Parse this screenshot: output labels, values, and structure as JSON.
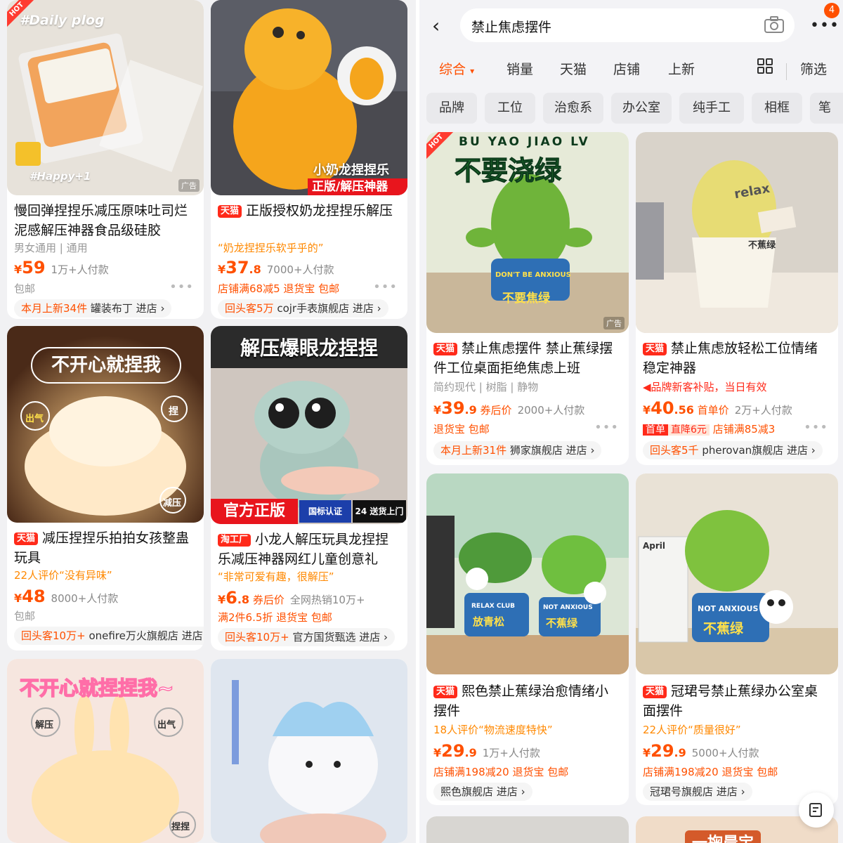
{
  "search": {
    "back_icon": "chevron-left-icon",
    "query": "禁止焦虑摆件",
    "camera_icon": "camera-icon",
    "more_icon": "more-dots-icon",
    "notification_count": "4"
  },
  "sort_tabs": [
    "综合",
    "销量",
    "天猫",
    "店铺",
    "上新"
  ],
  "sort_active": "综合",
  "layout_icon": "grid-view-icon",
  "filter_label": "筛选",
  "filter_chips": [
    "品牌",
    "工位",
    "治愈系",
    "办公室",
    "纯手工",
    "相框",
    "笔"
  ],
  "left_products": [
    {
      "hot": "HOT",
      "overlay_top": "#Daily plog",
      "overlay_bottom": "#Happy+1",
      "ad": "广告",
      "tag": "",
      "title": "慢回弹捏捏乐减压原味吐司烂泥感解压神器食品级硅胶",
      "subline": "男女通用 | 通用",
      "price_int": "59",
      "price_dec": "",
      "sales": "1万+人付款",
      "promo": "包邮",
      "shop_highlight": "本月上新34件",
      "shop_name": "罐装布丁 进店"
    },
    {
      "overlay_top": "",
      "overlay_bottom": "小奶龙捏捏乐",
      "overlay_banner": "正版/解压神器",
      "tag": "天猫",
      "title": "正版授权奶龙捏捏乐解压",
      "subline": "“奶龙捏捏乐软乎乎的”",
      "price_int": "37",
      "price_dec": ".8",
      "sales": "7000+人付款",
      "promo": "店铺满68减5  退货宝  包邮",
      "shop_highlight": "回头客5万",
      "shop_name": "cojr手表旗舰店 进店"
    },
    {
      "overlay_top": "不开心就捏我",
      "bubble_1": "出气",
      "bubble_2": "捏",
      "bubble_3": "减压",
      "tag": "天猫",
      "title": "减压捏捏乐拍拍女孩整蛊玩具",
      "subline": "22人评价“没有异味”",
      "price_int": "48",
      "price_dec": "",
      "sales": "8000+人付款",
      "promo": "包邮",
      "shop_highlight": "回头客10万+",
      "shop_name": "onefire万火旗舰店 进店"
    },
    {
      "overlay_top": "解压爆眼龙捏捏",
      "overlay_banner": "官方正版",
      "badge_cert": "国标认证",
      "badge_delivery": "24 送货上门",
      "tag": "淘工厂",
      "title": "小龙人解压玩具龙捏捏乐减压神器网红儿童创意礼",
      "subline": "“非常可爱有趣，很解压”",
      "price_int": "6",
      "price_dec": ".8",
      "price_note": "券后价",
      "sales": "全网热销10万+",
      "promo": "满2件6.5折  退货宝  包邮",
      "shop_highlight": "回头客10万+",
      "shop_name": "官方国货甄选 进店"
    },
    {
      "overlay_top": "不开心就捏捏我~",
      "bubble_1": "解压",
      "bubble_2": "出气",
      "bubble_3": "捏捏"
    },
    {
      "overlay_top": ""
    }
  ],
  "right_products": [
    {
      "hot": "HOT",
      "overlay_top": "BU YAO JIAO LV",
      "overlay_big": "不要浇绿",
      "pot_en": "DON'T BE ANXIOUS",
      "pot_cn": "不要焦绿",
      "ad": "广告",
      "tag": "天猫",
      "title": "禁止焦虑摆件  禁止蕉绿摆件工位桌面拒绝焦虑上班",
      "subline": "简约现代 | 树脂 | 静物",
      "price_int": "39",
      "price_dec": ".9",
      "price_note": "券后价",
      "sales": "2000+人付款",
      "promo": "退货宝  包邮",
      "shop_highlight": "本月上新31件",
      "shop_name": "狮家旗舰店 进店"
    },
    {
      "sign": "relax",
      "pot_cn": "不蕉绿",
      "tag": "天猫",
      "title": "禁止焦虑放轻松工位情绪稳定神器",
      "subline": "品牌新客补贴，当日有效",
      "price_int": "40",
      "price_dec": ".56",
      "price_note": "首单价",
      "sales": "2万+人付款",
      "first_order": "首单",
      "direct_cut": "直降6元",
      "promo": "店铺满85减3",
      "shop_highlight": "回头客5千",
      "shop_name": "pherovan旗舰店 进店"
    },
    {
      "pot_1_en": "RELAX CLUB",
      "pot_1_cn": "放青松",
      "pot_2_en": "NOT ANXIOUS",
      "pot_2_cn": "不蕉绿",
      "tag": "天猫",
      "title": "熙色禁止蕉绿治愈情绪小摆件",
      "subline": "18人评价“物流速度特快”",
      "price_int": "29",
      "price_dec": ".9",
      "sales": "1万+人付款",
      "promo": "店铺满198减20  退货宝  包邮",
      "shop_highlight": "",
      "shop_name": "熙色旗舰店 进店"
    },
    {
      "calendar": "April",
      "pot_en": "NOT ANXIOUS",
      "pot_cn": "不蕉绿",
      "tag": "天猫",
      "title": "冠珺号禁止蕉绿办公室桌面摆件",
      "subline": "22人评价“质量很好”",
      "price_int": "29",
      "price_dec": ".9",
      "sales": "5000+人付款",
      "promo": "店铺满198减20  退货宝  包邮",
      "shop_highlight": "",
      "shop_name": "冠珺号旗舰店 进店"
    },
    {
      "overlay_top": ""
    },
    {
      "overlay_top": "一掬晨宝"
    }
  ],
  "floating_button_icon": "feedback-edit-icon",
  "colors": {
    "accent": "#ff5000",
    "tmall_red": "#ff2a1a",
    "quote": "#ff8800"
  }
}
